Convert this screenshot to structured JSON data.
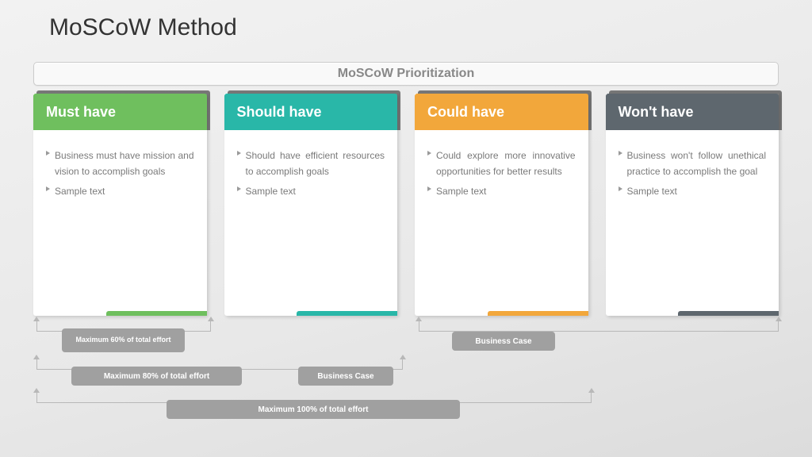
{
  "title": "MoSCoW Method",
  "subtitle": "MoSCoW Prioritization",
  "columns": [
    {
      "label": "Must have",
      "color": "#6fbf5e",
      "points": [
        "Business must have mission and vision to accomplish goals",
        "Sample text"
      ]
    },
    {
      "label": "Should have",
      "color": "#29b7a8",
      "points": [
        "Should have efficient resources to accomplish goals",
        "Sample text"
      ]
    },
    {
      "label": "Could have",
      "color": "#f2a73b",
      "points": [
        "Could explore more innovative opportunities for better results",
        "Sample text"
      ]
    },
    {
      "label": "Won't have",
      "color": "#5e676e",
      "points": [
        "Business won't follow unethical practice to accomplish the goal",
        "Sample text"
      ]
    }
  ],
  "efforts": {
    "e60": "Maximum 60% of total effort",
    "e80": "Maximum 80% of total effort",
    "bc1": "Business Case",
    "bc2": "Business Case",
    "e100": "Maximum 100% of total effort"
  }
}
